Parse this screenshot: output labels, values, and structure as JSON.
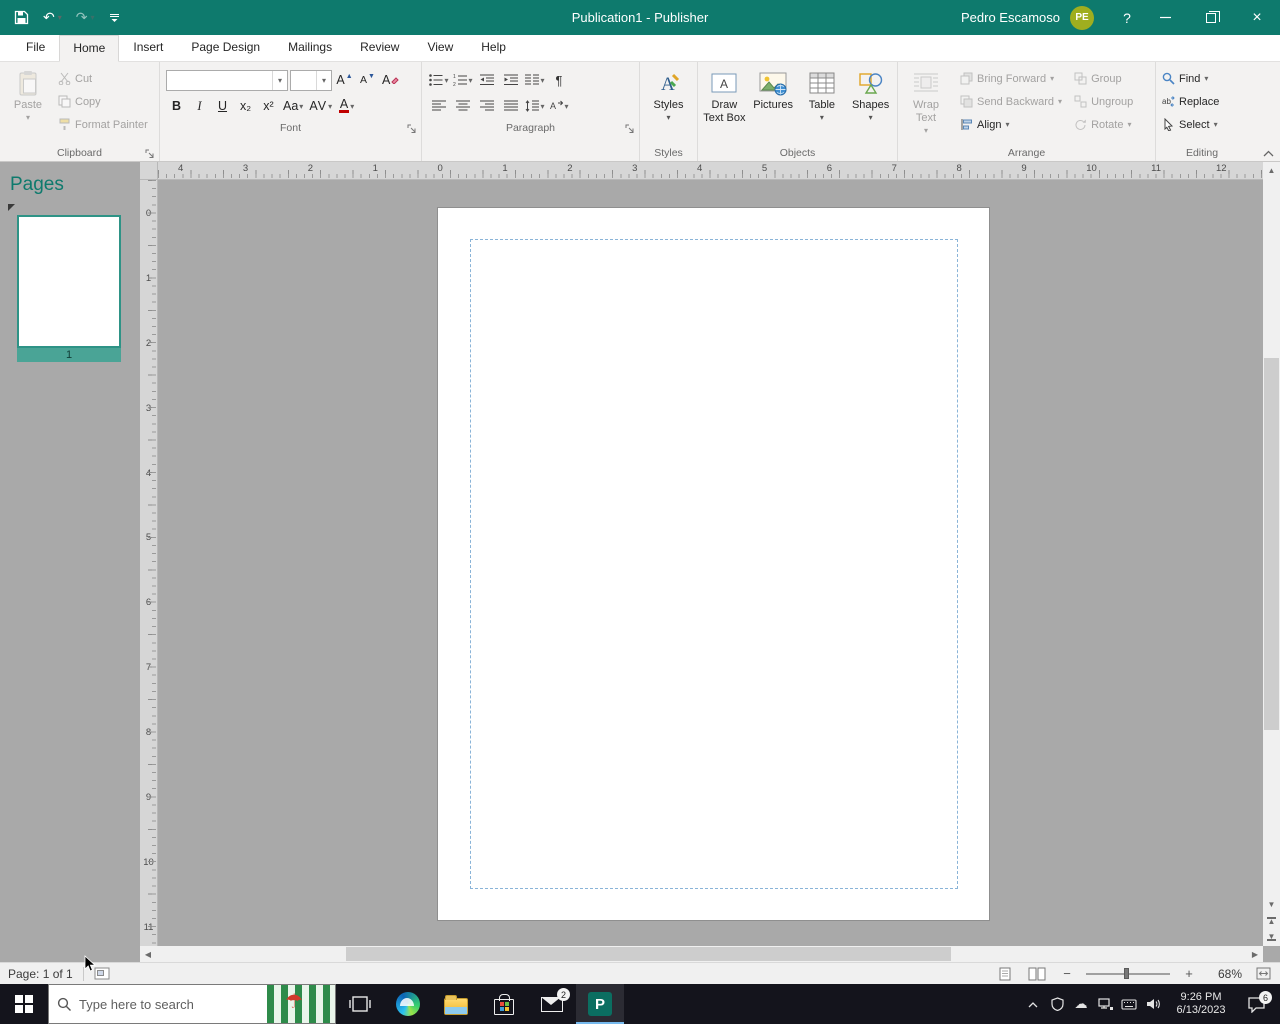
{
  "colors": {
    "titlebar": "#0e7a6d",
    "accent": "#0e7a6d",
    "avatar": "#9fae1f",
    "margin_guide": "#8ab4d8",
    "taskbar": "#14141c"
  },
  "titlebar": {
    "title": "Publication1  -  Publisher",
    "user_name": "Pedro Escamoso",
    "user_initials": "PE",
    "help_label": "?"
  },
  "quick_access": {
    "undo_glyph": "↶",
    "redo_glyph": "↷"
  },
  "tabs": [
    {
      "label": "File"
    },
    {
      "label": "Home",
      "active": true
    },
    {
      "label": "Insert"
    },
    {
      "label": "Page Design"
    },
    {
      "label": "Mailings"
    },
    {
      "label": "Review"
    },
    {
      "label": "View"
    },
    {
      "label": "Help"
    }
  ],
  "ribbon": {
    "clipboard": {
      "label": "Clipboard",
      "paste": "Paste",
      "cut": "Cut",
      "copy": "Copy",
      "format_painter": "Format Painter"
    },
    "font": {
      "label": "Font",
      "font_name_value": "",
      "font_size_value": "",
      "bold": "B",
      "italic": "I",
      "underline": "U",
      "subscript": "x₂",
      "superscript": "x²",
      "change_case": "Aa",
      "char_spacing": "AV",
      "font_color": "A",
      "grow_letter": "A",
      "shrink_letter": "A"
    },
    "paragraph": {
      "label": "Paragraph",
      "pilcrow": "¶"
    },
    "styles": {
      "label": "Styles",
      "styles_button": "Styles"
    },
    "objects": {
      "label": "Objects",
      "draw_text_box_1": "Draw",
      "draw_text_box_2": "Text Box",
      "pictures": "Pictures",
      "table": "Table",
      "shapes": "Shapes"
    },
    "arrange": {
      "label": "Arrange",
      "wrap_1": "Wrap",
      "wrap_2": "Text",
      "bring_forward": "Bring Forward",
      "send_backward": "Send Backward",
      "align": "Align",
      "group": "Group",
      "ungroup": "Ungroup",
      "rotate": "Rotate"
    },
    "editing": {
      "label": "Editing",
      "find": "Find",
      "replace": "Replace",
      "select": "Select"
    }
  },
  "pages_panel": {
    "title": "Pages",
    "page_thumbnail_number": "1"
  },
  "rulers": {
    "horizontal": [
      "4",
      "3",
      "2",
      "1",
      "0",
      "1",
      "2",
      "3",
      "4",
      "5",
      "6",
      "7",
      "8",
      "9",
      "10",
      "11",
      "12"
    ],
    "vertical": [
      "0",
      "1",
      "2",
      "3",
      "4",
      "5",
      "6",
      "7",
      "8",
      "9",
      "10",
      "11"
    ]
  },
  "statusbar": {
    "page_indicator": "Page: 1 of 1",
    "zoom_percent": "68%"
  },
  "taskbar": {
    "search_placeholder": "Type here to search",
    "mail_badge": "2",
    "clock_time": "9:26 PM",
    "clock_date": "6/13/2023",
    "action_center_badge": "6"
  }
}
